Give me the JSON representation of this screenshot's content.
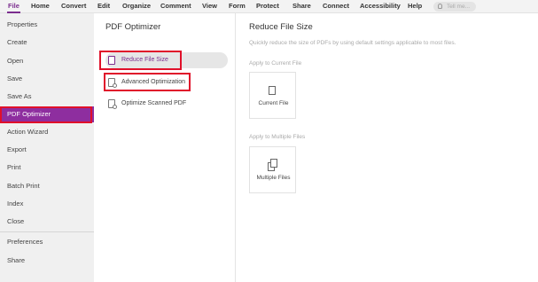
{
  "menu": {
    "items": [
      "File",
      "Home",
      "Convert",
      "Edit",
      "Organize",
      "Comment",
      "View",
      "Form",
      "Protect",
      "Share",
      "Connect",
      "Accessibility",
      "Help"
    ],
    "search_placeholder": "Tell me..."
  },
  "sidebar": {
    "items": [
      "Properties",
      "Create",
      "Open",
      "Save",
      "Save As",
      "PDF Optimizer",
      "Action Wizard",
      "Export",
      "Print",
      "Batch Print",
      "Index",
      "Close",
      "Preferences",
      "Share"
    ],
    "selected": "PDF Optimizer"
  },
  "middle": {
    "title": "PDF Optimizer",
    "options": [
      "Reduce File Size",
      "Advanced Optimization",
      "Optimize Scanned PDF"
    ]
  },
  "right": {
    "title": "Reduce File Size",
    "description": "Quickly reduce the size of PDFs by using default settings applicable to most files.",
    "current_section": "Apply to Current File",
    "current_card": "Current File",
    "multiple_section": "Apply to Multiple Files",
    "multiple_card": "Multiple Files"
  },
  "colors": {
    "accent": "#8e2e9f",
    "highlight_box": "#e0102a"
  }
}
